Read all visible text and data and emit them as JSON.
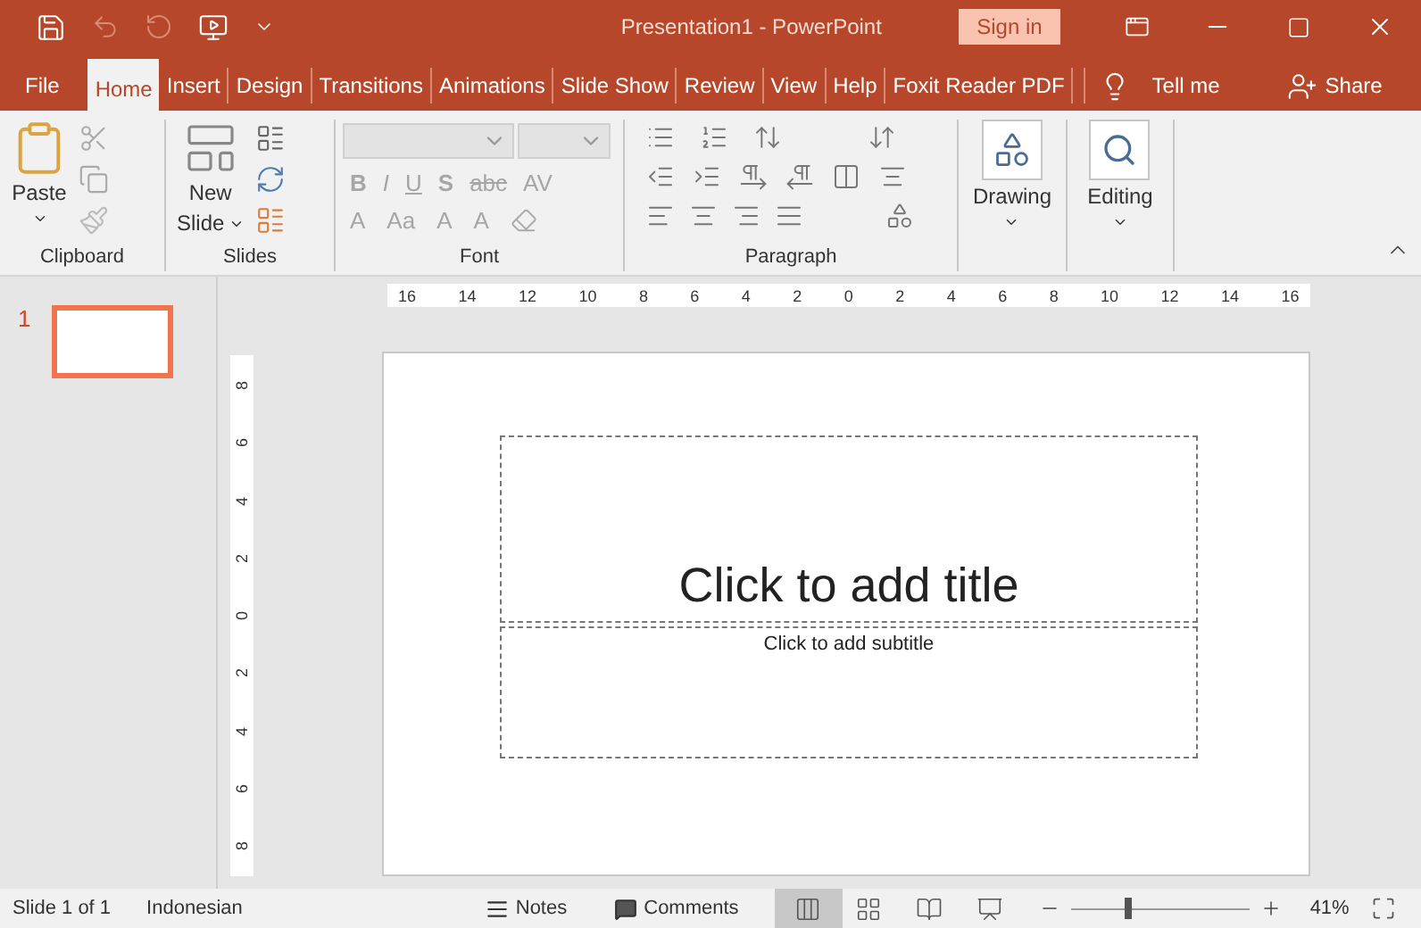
{
  "window": {
    "title": "Presentation1  -  PowerPoint",
    "sign_in": "Sign in"
  },
  "tabs": [
    {
      "label": "File",
      "selected": false
    },
    {
      "label": "Home",
      "selected": true
    },
    {
      "label": "Insert",
      "selected": false
    },
    {
      "label": "Design",
      "selected": false
    },
    {
      "label": "Transitions",
      "selected": false
    },
    {
      "label": "Animations",
      "selected": false
    },
    {
      "label": "Slide Show",
      "selected": false
    },
    {
      "label": "Review",
      "selected": false
    },
    {
      "label": "View",
      "selected": false
    },
    {
      "label": "Help",
      "selected": false
    },
    {
      "label": "Foxit Reader PDF",
      "selected": false
    }
  ],
  "tell_me": "Tell me",
  "share": "Share",
  "ribbon": {
    "clipboard": {
      "label": "Clipboard",
      "paste": "Paste"
    },
    "slides": {
      "label": "Slides",
      "new_slide": [
        "New",
        "Slide"
      ]
    },
    "font": {
      "label": "Font",
      "row1": [
        "B",
        "I",
        "U",
        "S",
        "abc",
        "AV"
      ],
      "row2": [
        "A",
        "Aa",
        "A",
        "A"
      ]
    },
    "paragraph": {
      "label": "Paragraph"
    },
    "drawing": {
      "label": "Drawing"
    },
    "editing": {
      "label": "Editing"
    }
  },
  "thumbnails": [
    {
      "number": "1",
      "selected": true
    }
  ],
  "ruler_h": [
    "16",
    "14",
    "12",
    "10",
    "8",
    "6",
    "4",
    "2",
    "0",
    "2",
    "4",
    "6",
    "8",
    "10",
    "12",
    "14",
    "16"
  ],
  "ruler_v": [
    "8",
    "6",
    "4",
    "2",
    "0",
    "2",
    "4",
    "6",
    "8"
  ],
  "slide": {
    "title_placeholder": "Click to add title",
    "subtitle_placeholder": "Click to add subtitle"
  },
  "status_bar": {
    "slide": "Slide 1 of 1",
    "language": "Indonesian",
    "notes": "Notes",
    "comments": "Comments",
    "views": [
      {
        "kind": "normal",
        "selected": true
      },
      {
        "kind": "sorter",
        "selected": false
      },
      {
        "kind": "reading",
        "selected": false
      },
      {
        "kind": "slideshow",
        "selected": false
      }
    ],
    "zoom": {
      "level": 0.3,
      "reading": "41%"
    }
  }
}
